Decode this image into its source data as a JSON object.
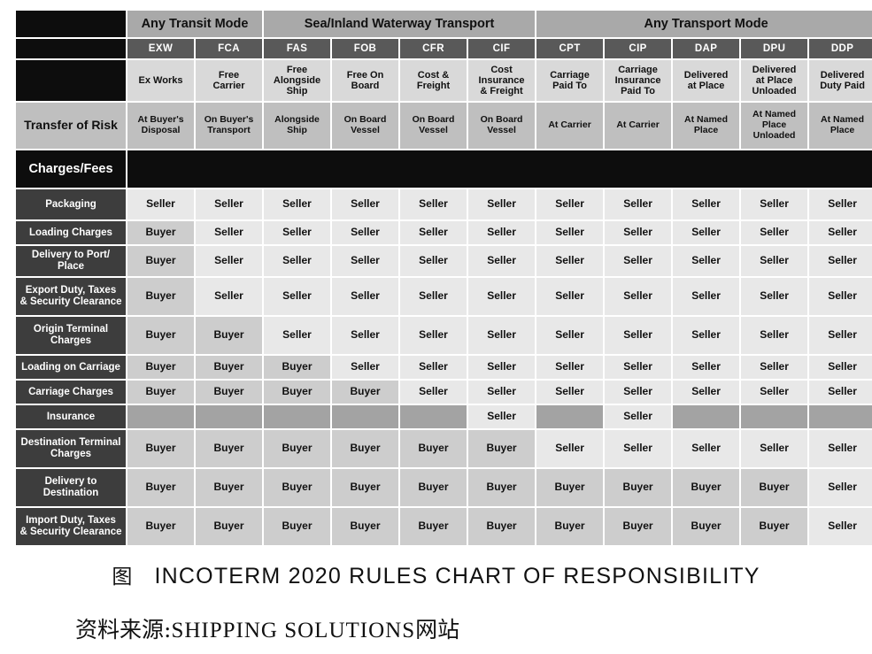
{
  "chart_data": {
    "type": "table",
    "title": "INCOTERM 2020 RULES CHART OF RESPONSIBILITY",
    "groups": [
      {
        "label": "Any Transit Mode",
        "span": 2
      },
      {
        "label": "Sea/Inland Waterway Transport",
        "span": 4
      },
      {
        "label": "Any Transport Mode",
        "span": 5
      }
    ],
    "codes": [
      "EXW",
      "FCA",
      "FAS",
      "FOB",
      "CFR",
      "CIF",
      "CPT",
      "CIP",
      "DAP",
      "DPU",
      "DDP"
    ],
    "names": [
      "Ex Works",
      "Free\nCarrier",
      "Free\nAlongside\nShip",
      "Free On\nBoard",
      "Cost &\nFreight",
      "Cost\nInsurance\n& Freight",
      "Carriage\nPaid To",
      "Carriage\nInsurance\nPaid To",
      "Delivered\nat Place",
      "Delivered\nat Place\nUnloaded",
      "Delivered\nDuty Paid"
    ],
    "risk_row_label": "Transfer of Risk",
    "risk_values": [
      "At Buyer's\nDisposal",
      "On Buyer's\nTransport",
      "Alongside\nShip",
      "On Board\nVessel",
      "On Board\nVessel",
      "On Board\nVessel",
      "At Carrier",
      "At Carrier",
      "At Named\nPlace",
      "At Named\nPlace\nUnloaded",
      "At Named\nPlace"
    ],
    "section_label": "Charges/Fees",
    "rows": [
      {
        "label": "Packaging",
        "height": "r-h34",
        "values": [
          "Seller",
          "Seller",
          "Seller",
          "Seller",
          "Seller",
          "Seller",
          "Seller",
          "Seller",
          "Seller",
          "Seller",
          "Seller"
        ]
      },
      {
        "label": "Loading Charges",
        "height": "r-h26",
        "values": [
          "Buyer",
          "Seller",
          "Seller",
          "Seller",
          "Seller",
          "Seller",
          "Seller",
          "Seller",
          "Seller",
          "Seller",
          "Seller"
        ]
      },
      {
        "label": "Delivery to Port/\nPlace",
        "height": "r-h34",
        "values": [
          "Buyer",
          "Seller",
          "Seller",
          "Seller",
          "Seller",
          "Seller",
          "Seller",
          "Seller",
          "Seller",
          "Seller",
          "Seller"
        ]
      },
      {
        "label": "Export Duty, Taxes\n& Security Clearance",
        "height": "r-h42",
        "values": [
          "Buyer",
          "Seller",
          "Seller",
          "Seller",
          "Seller",
          "Seller",
          "Seller",
          "Seller",
          "Seller",
          "Seller",
          "Seller"
        ]
      },
      {
        "label": "Origin Terminal\nCharges",
        "height": "r-h42",
        "values": [
          "Buyer",
          "Buyer",
          "Seller",
          "Seller",
          "Seller",
          "Seller",
          "Seller",
          "Seller",
          "Seller",
          "Seller",
          "Seller"
        ]
      },
      {
        "label": "Loading on Carriage",
        "height": "r-h26",
        "values": [
          "Buyer",
          "Buyer",
          "Buyer",
          "Seller",
          "Seller",
          "Seller",
          "Seller",
          "Seller",
          "Seller",
          "Seller",
          "Seller"
        ]
      },
      {
        "label": "Carriage Charges",
        "height": "r-h26",
        "values": [
          "Buyer",
          "Buyer",
          "Buyer",
          "Buyer",
          "Seller",
          "Seller",
          "Seller",
          "Seller",
          "Seller",
          "Seller",
          "Seller"
        ]
      },
      {
        "label": "Insurance",
        "height": "r-h26",
        "values": [
          "",
          "",
          "",
          "",
          "",
          "Seller",
          "",
          "Seller",
          "",
          "",
          ""
        ]
      },
      {
        "label": "Destination Terminal\nCharges",
        "height": "r-h42",
        "values": [
          "Buyer",
          "Buyer",
          "Buyer",
          "Buyer",
          "Buyer",
          "Buyer",
          "Seller",
          "Seller",
          "Seller",
          "Seller",
          "Seller"
        ]
      },
      {
        "label": "Delivery to\nDestination",
        "height": "r-h42",
        "values": [
          "Buyer",
          "Buyer",
          "Buyer",
          "Buyer",
          "Buyer",
          "Buyer",
          "Buyer",
          "Buyer",
          "Buyer",
          "Buyer",
          "Seller"
        ]
      },
      {
        "label": "Import Duty, Taxes\n& Security Clearance",
        "height": "r-h42",
        "values": [
          "Buyer",
          "Buyer",
          "Buyer",
          "Buyer",
          "Buyer",
          "Buyer",
          "Buyer",
          "Buyer",
          "Buyer",
          "Buyer",
          "Seller"
        ]
      }
    ],
    "colors": {
      "black": "#0d0d0d",
      "group_header": "#a9a9a9",
      "code_header": "#595959",
      "name_header": "#d9d9d9",
      "risk": "#bfbfbf",
      "row_label": "#3d3d3d",
      "seller": "#e8e8e8",
      "buyer": "#cdcdcd",
      "empty": "#a3a3a3"
    }
  },
  "caption": {
    "figure_marker": "图",
    "figure_title": "INCOTERM 2020 RULES CHART OF RESPONSIBILITY",
    "source_prefix": "资料来源:",
    "source_name": "SHIPPING  SOLUTIONS",
    "source_suffix": "网站"
  }
}
